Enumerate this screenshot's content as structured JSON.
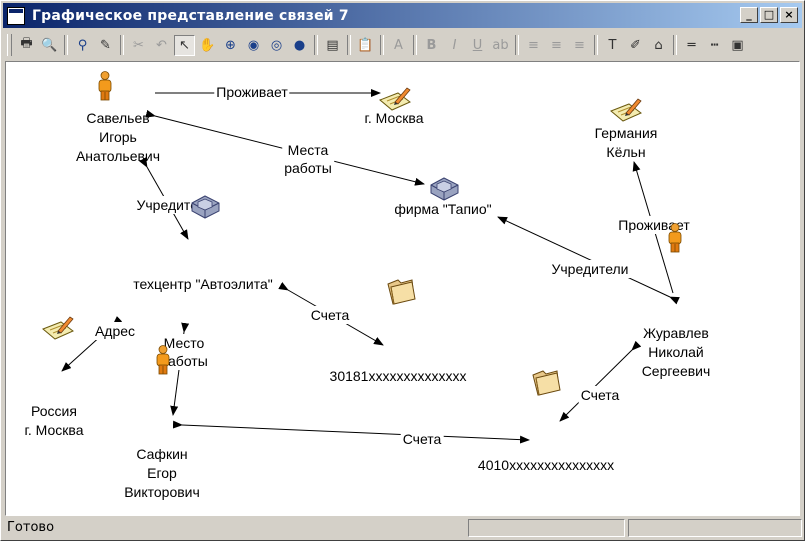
{
  "window": {
    "title": "Графическое представление связей 7"
  },
  "toolbar": {
    "icons": [
      "print-icon",
      "print-preview-icon",
      "sep",
      "find-icon",
      "pin-icon",
      "sep",
      "cut-icon",
      "undo-icon",
      "pointer-icon",
      "hand-icon",
      "zoom-in-icon",
      "zoom-icon",
      "zoom-fit-icon",
      "zoom-out-icon",
      "sep",
      "properties-icon",
      "sep",
      "paste-icon",
      "sep",
      "font-icon",
      "sep",
      "bold-icon",
      "italic-icon",
      "underline-icon",
      "strike-icon",
      "sep",
      "align-left-icon",
      "align-center-icon",
      "align-right-icon",
      "sep",
      "text-tool-icon",
      "pen-icon",
      "fill-icon",
      "sep",
      "line-icon",
      "line-style-icon",
      "frame-icon"
    ]
  },
  "diagram": {
    "nodes": [
      {
        "id": "savelyev",
        "type": "person",
        "lines": [
          "Савельев",
          "Игорь",
          "Анатольевич"
        ]
      },
      {
        "id": "moscow",
        "type": "address",
        "lines": [
          "г. Москва"
        ]
      },
      {
        "id": "germany",
        "type": "address",
        "lines": [
          "Германия",
          "Кёльн"
        ]
      },
      {
        "id": "tapio",
        "type": "company",
        "lines": [
          "фирма \"Тапио\""
        ]
      },
      {
        "id": "autoelite",
        "type": "company",
        "lines": [
          "техцентр \"Автоэлита\""
        ]
      },
      {
        "id": "acc30181",
        "type": "account",
        "lines": [
          "30181xxxxxxxxxxxxxx"
        ]
      },
      {
        "id": "russia",
        "type": "address",
        "lines": [
          "Россия",
          "г. Москва"
        ]
      },
      {
        "id": "zhuravlev",
        "type": "person",
        "lines": [
          "Журавлев",
          "Николай",
          "Сергеевич"
        ]
      },
      {
        "id": "safkin",
        "type": "person",
        "lines": [
          "Сафкин",
          "Егор",
          "Викторович"
        ]
      },
      {
        "id": "acc4010",
        "type": "account",
        "lines": [
          "4010xxxxxxxxxxxxxxx"
        ]
      }
    ],
    "edges": [
      {
        "from": "savelyev",
        "to": "moscow",
        "lines": [
          "Проживает"
        ]
      },
      {
        "from": "savelyev",
        "to": "tapio",
        "lines": [
          "Места",
          "работы"
        ]
      },
      {
        "from": "savelyev",
        "to": "autoelite",
        "lines": [
          "Учредители"
        ]
      },
      {
        "from": "zhuravlev",
        "to": "germany",
        "lines": [
          "Проживает"
        ]
      },
      {
        "from": "zhuravlev",
        "to": "tapio",
        "lines": [
          "Учредители"
        ]
      },
      {
        "from": "autoelite",
        "to": "acc30181",
        "lines": [
          "Счета"
        ]
      },
      {
        "from": "autoelite",
        "to": "russia",
        "lines": [
          "Адрес"
        ]
      },
      {
        "from": "autoelite",
        "to": "safkin",
        "lines": [
          "Место",
          "работы"
        ]
      },
      {
        "from": "safkin",
        "to": "acc4010",
        "lines": [
          "Счета"
        ]
      },
      {
        "from": "zhuravlev",
        "to": "acc4010",
        "lines": [
          "Счета"
        ]
      }
    ]
  },
  "status": {
    "text": "Готово"
  }
}
